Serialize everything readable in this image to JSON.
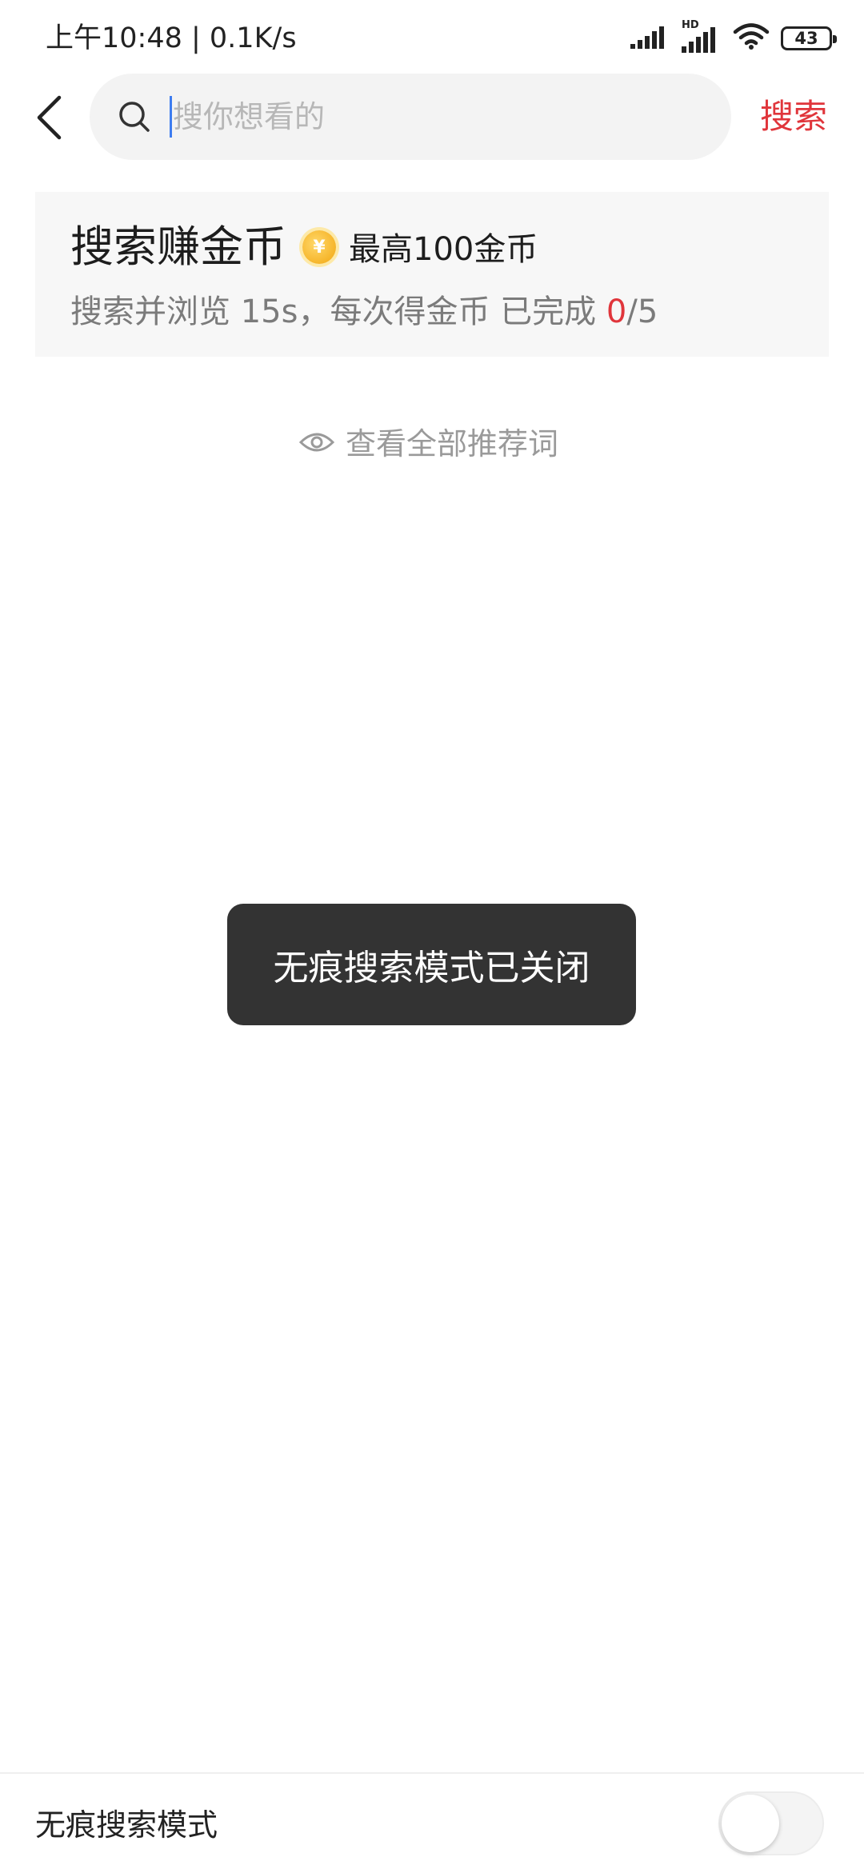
{
  "status_bar": {
    "time_speed": "上午10:48 | 0.1K/s",
    "network_label": "HD",
    "battery": "43",
    "icons": [
      "signal-icon",
      "hd-signal-icon",
      "wifi-icon",
      "battery-icon"
    ]
  },
  "header": {
    "back_icon": "chevron-left-icon",
    "search_icon": "search-icon",
    "search_placeholder": "搜你想看的",
    "search_button_label": "搜索"
  },
  "coin_card": {
    "title": "搜索赚金币",
    "coin_symbol": "¥",
    "max_label": "最高100金币",
    "desc_prefix": "搜索并浏览 15s，每次得金币 已完成 ",
    "done_count": "0",
    "total_suffix": "/5"
  },
  "view_all": {
    "icon": "eye-icon",
    "label": "查看全部推荐词"
  },
  "toast": {
    "text": "无痕搜索模式已关闭"
  },
  "bottom_bar": {
    "label": "无痕搜索模式",
    "toggle_on": false
  },
  "colors": {
    "accent": "#e0353b",
    "toast_bg": "#333333",
    "card_bg": "#f7f7f7",
    "search_bg": "#f3f3f3"
  }
}
